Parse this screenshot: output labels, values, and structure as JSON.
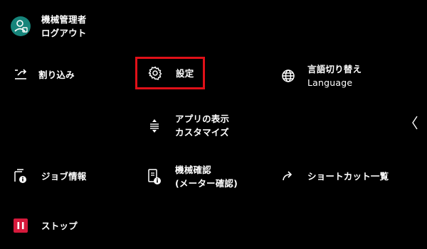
{
  "user": {
    "name": "機械管理者",
    "action": "ログアウト",
    "icon": "user-icon",
    "accent": "#16847a"
  },
  "menu": {
    "interrupt": {
      "label": "割り込み",
      "icon": "interrupt-icon"
    },
    "settings": {
      "label": "設定",
      "icon": "gear-icon",
      "highlight": "#e01018"
    },
    "language": {
      "label": "言語切り替え",
      "sublabel": "Language",
      "icon": "globe-icon"
    },
    "customize": {
      "label": "アプリの表示",
      "sublabel": "カスタマイズ",
      "icon": "sort-icon"
    },
    "job": {
      "label": "ジョブ情報",
      "icon": "job-info-icon"
    },
    "machine": {
      "label": "機械確認",
      "sublabel": "(メーター確認)",
      "icon": "machine-check-icon"
    },
    "shortcut": {
      "label": "ショートカット一覧",
      "icon": "share-arrow-icon"
    },
    "stop": {
      "label": "ストップ",
      "icon": "pause-icon",
      "color": "#d61a3c"
    }
  },
  "collapse": {
    "icon": "chevron-left-icon"
  }
}
